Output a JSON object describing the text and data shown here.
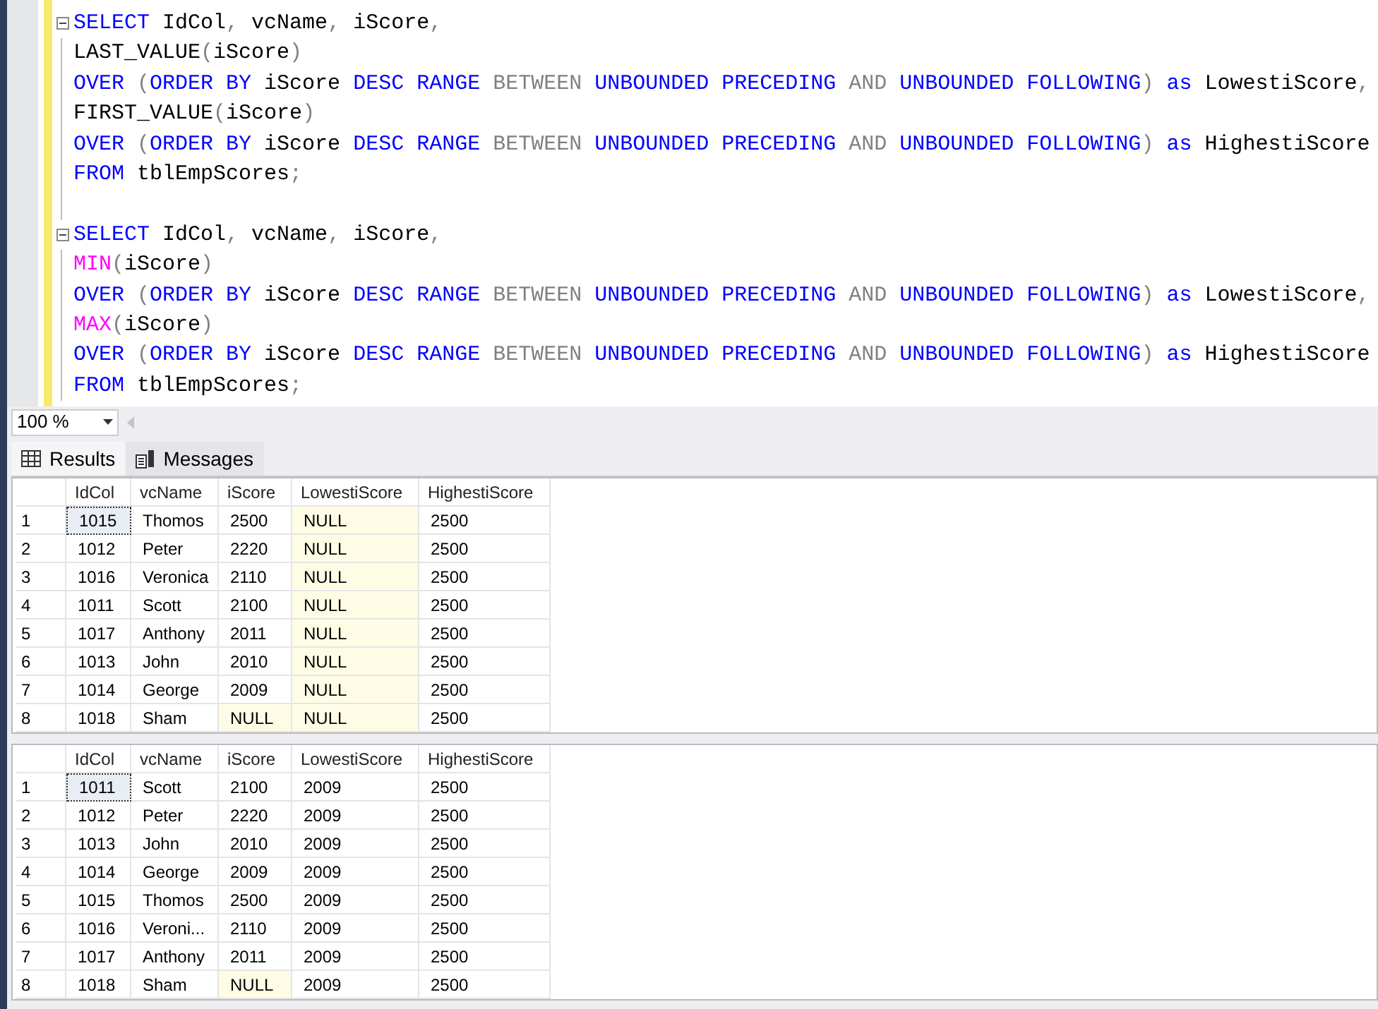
{
  "editor": {
    "statements": [
      {
        "expanded": true,
        "lines": [
          [
            {
              "text": "SELECT",
              "kind": "keyword"
            },
            {
              "text": " IdCol",
              "kind": "plain"
            },
            {
              "text": ",",
              "kind": "operator"
            },
            {
              "text": " vcName",
              "kind": "plain"
            },
            {
              "text": ",",
              "kind": "operator"
            },
            {
              "text": " iScore",
              "kind": "plain"
            },
            {
              "text": ",",
              "kind": "operator"
            }
          ],
          [
            {
              "text": "LAST_VALUE",
              "kind": "plain"
            },
            {
              "text": "(",
              "kind": "operator"
            },
            {
              "text": "iScore",
              "kind": "plain"
            },
            {
              "text": ")",
              "kind": "operator"
            }
          ],
          [
            {
              "text": "OVER ",
              "kind": "keyword"
            },
            {
              "text": "(",
              "kind": "operator"
            },
            {
              "text": "ORDER BY",
              "kind": "keyword"
            },
            {
              "text": " iScore ",
              "kind": "plain"
            },
            {
              "text": "DESC RANGE ",
              "kind": "keyword"
            },
            {
              "text": "BETWEEN ",
              "kind": "operator"
            },
            {
              "text": "UNBOUNDED PRECEDING ",
              "kind": "keyword"
            },
            {
              "text": "AND ",
              "kind": "operator"
            },
            {
              "text": "UNBOUNDED FOLLOWING",
              "kind": "keyword"
            },
            {
              "text": ")",
              "kind": "operator"
            },
            {
              "text": " as",
              "kind": "keyword"
            },
            {
              "text": " LowestiScore",
              "kind": "plain"
            },
            {
              "text": ",",
              "kind": "operator"
            }
          ],
          [
            {
              "text": "FIRST_VALUE",
              "kind": "plain"
            },
            {
              "text": "(",
              "kind": "operator"
            },
            {
              "text": "iScore",
              "kind": "plain"
            },
            {
              "text": ")",
              "kind": "operator"
            }
          ],
          [
            {
              "text": "OVER ",
              "kind": "keyword"
            },
            {
              "text": "(",
              "kind": "operator"
            },
            {
              "text": "ORDER BY",
              "kind": "keyword"
            },
            {
              "text": " iScore ",
              "kind": "plain"
            },
            {
              "text": "DESC RANGE ",
              "kind": "keyword"
            },
            {
              "text": "BETWEEN ",
              "kind": "operator"
            },
            {
              "text": "UNBOUNDED PRECEDING ",
              "kind": "keyword"
            },
            {
              "text": "AND ",
              "kind": "operator"
            },
            {
              "text": "UNBOUNDED FOLLOWING",
              "kind": "keyword"
            },
            {
              "text": ")",
              "kind": "operator"
            },
            {
              "text": " as",
              "kind": "keyword"
            },
            {
              "text": " HighestiScore",
              "kind": "plain"
            }
          ],
          [
            {
              "text": "FROM",
              "kind": "keyword"
            },
            {
              "text": " tblEmpScores",
              "kind": "plain"
            },
            {
              "text": ";",
              "kind": "operator"
            }
          ]
        ]
      },
      {
        "expanded": true,
        "lines": [
          [
            {
              "text": "SELECT",
              "kind": "keyword"
            },
            {
              "text": " IdCol",
              "kind": "plain"
            },
            {
              "text": ",",
              "kind": "operator"
            },
            {
              "text": " vcName",
              "kind": "plain"
            },
            {
              "text": ",",
              "kind": "operator"
            },
            {
              "text": " iScore",
              "kind": "plain"
            },
            {
              "text": ",",
              "kind": "operator"
            }
          ],
          [
            {
              "text": "MIN",
              "kind": "function"
            },
            {
              "text": "(",
              "kind": "operator"
            },
            {
              "text": "iScore",
              "kind": "plain"
            },
            {
              "text": ")",
              "kind": "operator"
            }
          ],
          [
            {
              "text": "OVER ",
              "kind": "keyword"
            },
            {
              "text": "(",
              "kind": "operator"
            },
            {
              "text": "ORDER BY",
              "kind": "keyword"
            },
            {
              "text": " iScore ",
              "kind": "plain"
            },
            {
              "text": "DESC RANGE ",
              "kind": "keyword"
            },
            {
              "text": "BETWEEN ",
              "kind": "operator"
            },
            {
              "text": "UNBOUNDED PRECEDING ",
              "kind": "keyword"
            },
            {
              "text": "AND ",
              "kind": "operator"
            },
            {
              "text": "UNBOUNDED FOLLOWING",
              "kind": "keyword"
            },
            {
              "text": ")",
              "kind": "operator"
            },
            {
              "text": " as",
              "kind": "keyword"
            },
            {
              "text": " LowestiScore",
              "kind": "plain"
            },
            {
              "text": ",",
              "kind": "operator"
            }
          ],
          [
            {
              "text": "MAX",
              "kind": "function"
            },
            {
              "text": "(",
              "kind": "operator"
            },
            {
              "text": "iScore",
              "kind": "plain"
            },
            {
              "text": ")",
              "kind": "operator"
            }
          ],
          [
            {
              "text": "OVER ",
              "kind": "keyword"
            },
            {
              "text": "(",
              "kind": "operator"
            },
            {
              "text": "ORDER BY",
              "kind": "keyword"
            },
            {
              "text": " iScore ",
              "kind": "plain"
            },
            {
              "text": "DESC RANGE ",
              "kind": "keyword"
            },
            {
              "text": "BETWEEN ",
              "kind": "operator"
            },
            {
              "text": "UNBOUNDED PRECEDING ",
              "kind": "keyword"
            },
            {
              "text": "AND ",
              "kind": "operator"
            },
            {
              "text": "UNBOUNDED FOLLOWING",
              "kind": "keyword"
            },
            {
              "text": ")",
              "kind": "operator"
            },
            {
              "text": " as",
              "kind": "keyword"
            },
            {
              "text": " HighestiScore",
              "kind": "plain"
            }
          ],
          [
            {
              "text": "FROM",
              "kind": "keyword"
            },
            {
              "text": " tblEmpScores",
              "kind": "plain"
            },
            {
              "text": ";",
              "kind": "operator"
            }
          ]
        ]
      }
    ]
  },
  "zoom": "100 %",
  "tabs": [
    {
      "label": "Results",
      "selected": true,
      "kind": "grid"
    },
    {
      "label": "Messages",
      "selected": false,
      "kind": "messages"
    }
  ],
  "grids": [
    {
      "columns": [
        "IdCol",
        "vcName",
        "iScore",
        "LowestiScore",
        "HighestiScore"
      ],
      "rows": [
        {
          "number": "1",
          "cells": [
            {
              "text": "1015",
              "null": false,
              "focused": true
            },
            {
              "text": "Thomos",
              "null": false,
              "focused": false
            },
            {
              "text": "2500",
              "null": false,
              "focused": false
            },
            {
              "text": "NULL",
              "null": true,
              "focused": false
            },
            {
              "text": "2500",
              "null": false,
              "focused": false
            }
          ]
        },
        {
          "number": "2",
          "cells": [
            {
              "text": "1012",
              "null": false,
              "focused": false
            },
            {
              "text": "Peter",
              "null": false,
              "focused": false
            },
            {
              "text": "2220",
              "null": false,
              "focused": false
            },
            {
              "text": "NULL",
              "null": true,
              "focused": false
            },
            {
              "text": "2500",
              "null": false,
              "focused": false
            }
          ]
        },
        {
          "number": "3",
          "cells": [
            {
              "text": "1016",
              "null": false,
              "focused": false
            },
            {
              "text": "Veronica",
              "null": false,
              "focused": false
            },
            {
              "text": "2110",
              "null": false,
              "focused": false
            },
            {
              "text": "NULL",
              "null": true,
              "focused": false
            },
            {
              "text": "2500",
              "null": false,
              "focused": false
            }
          ]
        },
        {
          "number": "4",
          "cells": [
            {
              "text": "1011",
              "null": false,
              "focused": false
            },
            {
              "text": "Scott",
              "null": false,
              "focused": false
            },
            {
              "text": "2100",
              "null": false,
              "focused": false
            },
            {
              "text": "NULL",
              "null": true,
              "focused": false
            },
            {
              "text": "2500",
              "null": false,
              "focused": false
            }
          ]
        },
        {
          "number": "5",
          "cells": [
            {
              "text": "1017",
              "null": false,
              "focused": false
            },
            {
              "text": "Anthony",
              "null": false,
              "focused": false
            },
            {
              "text": "2011",
              "null": false,
              "focused": false
            },
            {
              "text": "NULL",
              "null": true,
              "focused": false
            },
            {
              "text": "2500",
              "null": false,
              "focused": false
            }
          ]
        },
        {
          "number": "6",
          "cells": [
            {
              "text": "1013",
              "null": false,
              "focused": false
            },
            {
              "text": "John",
              "null": false,
              "focused": false
            },
            {
              "text": "2010",
              "null": false,
              "focused": false
            },
            {
              "text": "NULL",
              "null": true,
              "focused": false
            },
            {
              "text": "2500",
              "null": false,
              "focused": false
            }
          ]
        },
        {
          "number": "7",
          "cells": [
            {
              "text": "1014",
              "null": false,
              "focused": false
            },
            {
              "text": "George",
              "null": false,
              "focused": false
            },
            {
              "text": "2009",
              "null": false,
              "focused": false
            },
            {
              "text": "NULL",
              "null": true,
              "focused": false
            },
            {
              "text": "2500",
              "null": false,
              "focused": false
            }
          ]
        },
        {
          "number": "8",
          "cells": [
            {
              "text": "1018",
              "null": false,
              "focused": false
            },
            {
              "text": "Sham",
              "null": false,
              "focused": false
            },
            {
              "text": "NULL",
              "null": true,
              "focused": false
            },
            {
              "text": "NULL",
              "null": true,
              "focused": false
            },
            {
              "text": "2500",
              "null": false,
              "focused": false
            }
          ]
        }
      ]
    },
    {
      "columns": [
        "IdCol",
        "vcName",
        "iScore",
        "LowestiScore",
        "HighestiScore"
      ],
      "rows": [
        {
          "number": "1",
          "cells": [
            {
              "text": "1011",
              "null": false,
              "focused": true
            },
            {
              "text": "Scott",
              "null": false,
              "focused": false
            },
            {
              "text": "2100",
              "null": false,
              "focused": false
            },
            {
              "text": "2009",
              "null": false,
              "focused": false
            },
            {
              "text": "2500",
              "null": false,
              "focused": false
            }
          ]
        },
        {
          "number": "2",
          "cells": [
            {
              "text": "1012",
              "null": false,
              "focused": false
            },
            {
              "text": "Peter",
              "null": false,
              "focused": false
            },
            {
              "text": "2220",
              "null": false,
              "focused": false
            },
            {
              "text": "2009",
              "null": false,
              "focused": false
            },
            {
              "text": "2500",
              "null": false,
              "focused": false
            }
          ]
        },
        {
          "number": "3",
          "cells": [
            {
              "text": "1013",
              "null": false,
              "focused": false
            },
            {
              "text": "John",
              "null": false,
              "focused": false
            },
            {
              "text": "2010",
              "null": false,
              "focused": false
            },
            {
              "text": "2009",
              "null": false,
              "focused": false
            },
            {
              "text": "2500",
              "null": false,
              "focused": false
            }
          ]
        },
        {
          "number": "4",
          "cells": [
            {
              "text": "1014",
              "null": false,
              "focused": false
            },
            {
              "text": "George",
              "null": false,
              "focused": false
            },
            {
              "text": "2009",
              "null": false,
              "focused": false
            },
            {
              "text": "2009",
              "null": false,
              "focused": false
            },
            {
              "text": "2500",
              "null": false,
              "focused": false
            }
          ]
        },
        {
          "number": "5",
          "cells": [
            {
              "text": "1015",
              "null": false,
              "focused": false
            },
            {
              "text": "Thomos",
              "null": false,
              "focused": false
            },
            {
              "text": "2500",
              "null": false,
              "focused": false
            },
            {
              "text": "2009",
              "null": false,
              "focused": false
            },
            {
              "text": "2500",
              "null": false,
              "focused": false
            }
          ]
        },
        {
          "number": "6",
          "cells": [
            {
              "text": "1016",
              "null": false,
              "focused": false
            },
            {
              "text": "Veroni...",
              "null": false,
              "focused": false
            },
            {
              "text": "2110",
              "null": false,
              "focused": false
            },
            {
              "text": "2009",
              "null": false,
              "focused": false
            },
            {
              "text": "2500",
              "null": false,
              "focused": false
            }
          ]
        },
        {
          "number": "7",
          "cells": [
            {
              "text": "1017",
              "null": false,
              "focused": false
            },
            {
              "text": "Anthony",
              "null": false,
              "focused": false
            },
            {
              "text": "2011",
              "null": false,
              "focused": false
            },
            {
              "text": "2009",
              "null": false,
              "focused": false
            },
            {
              "text": "2500",
              "null": false,
              "focused": false
            }
          ]
        },
        {
          "number": "8",
          "cells": [
            {
              "text": "1018",
              "null": false,
              "focused": false
            },
            {
              "text": "Sham",
              "null": false,
              "focused": false
            },
            {
              "text": "NULL",
              "null": true,
              "focused": false
            },
            {
              "text": "2009",
              "null": false,
              "focused": false
            },
            {
              "text": "2500",
              "null": false,
              "focused": false
            }
          ]
        }
      ]
    }
  ]
}
